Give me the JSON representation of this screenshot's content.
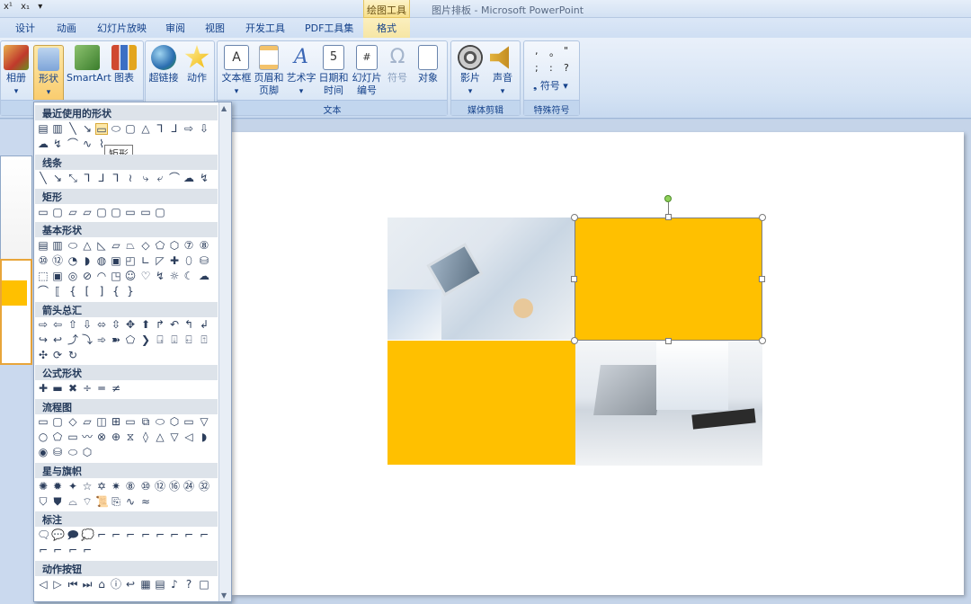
{
  "title_bar": {
    "quick_access": [
      "x¹",
      "x₁"
    ],
    "title": "图片排板 - Microsoft PowerPoint",
    "context_label": "绘图工具"
  },
  "tabs": [
    "设计",
    "动画",
    "幻灯片放映",
    "审阅",
    "视图",
    "开发工具",
    "PDF工具集",
    "格式"
  ],
  "ribbon": {
    "buttons": {
      "album": "相册",
      "shapes": "形状",
      "smartart": "SmartArt",
      "chart": "图表",
      "hyperlink": "超链接",
      "action": "动作",
      "textbox": "文本框",
      "header_footer": "页眉和页脚",
      "wordart": "艺术字",
      "datetime": "日期和时间",
      "slide_number": "幻灯片编号",
      "symbol": "符号",
      "object": "对象",
      "movie": "影片",
      "sound": "声音",
      "special_symbol": "符号"
    },
    "groups": {
      "text": "文本",
      "media": "媒体剪辑",
      "special": "特殊符号"
    },
    "symbols": [
      ",",
      "。",
      ";",
      ":",
      "?"
    ]
  },
  "gallery": {
    "sections": [
      "最近使用的形状",
      "线条",
      "矩形",
      "基本形状",
      "箭头总汇",
      "公式形状",
      "流程图",
      "星与旗帜",
      "标注",
      "动作按钮"
    ],
    "tooltip": "矩形"
  },
  "colors": {
    "accent": "#ffc000",
    "ribbon_bg": "#d5e3f4",
    "selected": "#f9c764"
  }
}
